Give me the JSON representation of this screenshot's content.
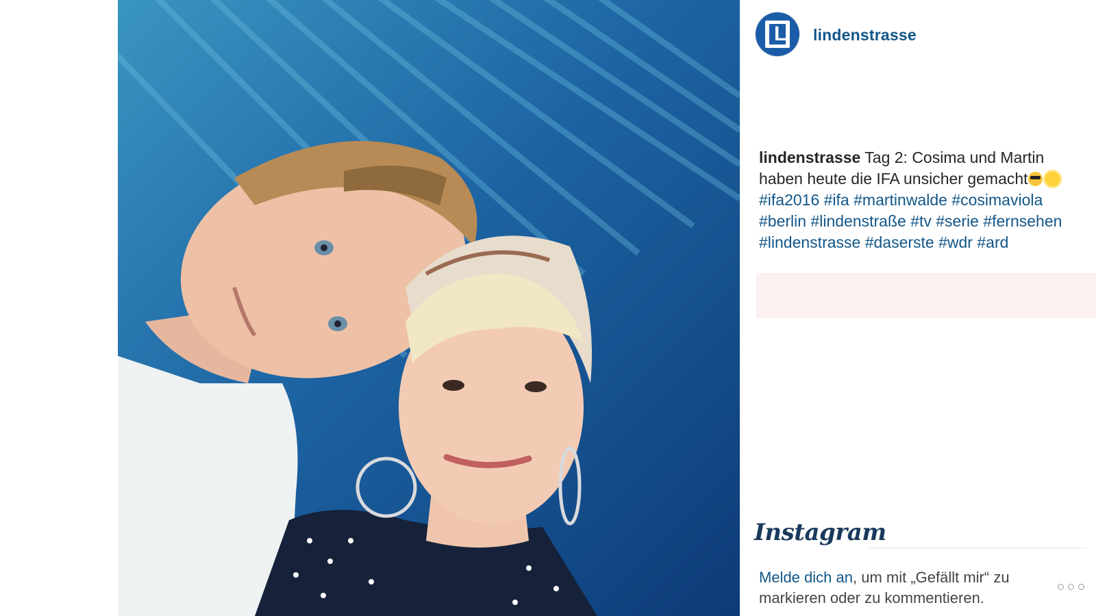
{
  "post": {
    "username": "lindenstrasse",
    "avatar_letter": "L",
    "image_alt": "Selfie of two people against a blue wall",
    "caption": {
      "user": "lindenstrasse",
      "text": " Tag 2: Cosima und Martin haben heute die IFA unsicher gemacht",
      "emojis": [
        "smiling-face-with-sunglasses-icon",
        "sun-icon"
      ],
      "hashtags": [
        "#ifa2016",
        "#ifa",
        "#martinwalde",
        "#cosimaviola",
        "#berlin",
        "#lindenstraße",
        "#tv",
        "#serie",
        "#fernsehen",
        "#lindenstrasse",
        "#daserste",
        "#wdr",
        "#ard"
      ]
    }
  },
  "footer": {
    "brand": "Instagram",
    "login_link": "Melde dich an",
    "login_rest": ", um mit „Gefällt mir“ zu markieren oder zu kommentieren.",
    "more_icon": "more-dots-icon"
  },
  "colors": {
    "link": "#125688",
    "text": "#262626",
    "avatar_bg": "#1b5ca8"
  }
}
